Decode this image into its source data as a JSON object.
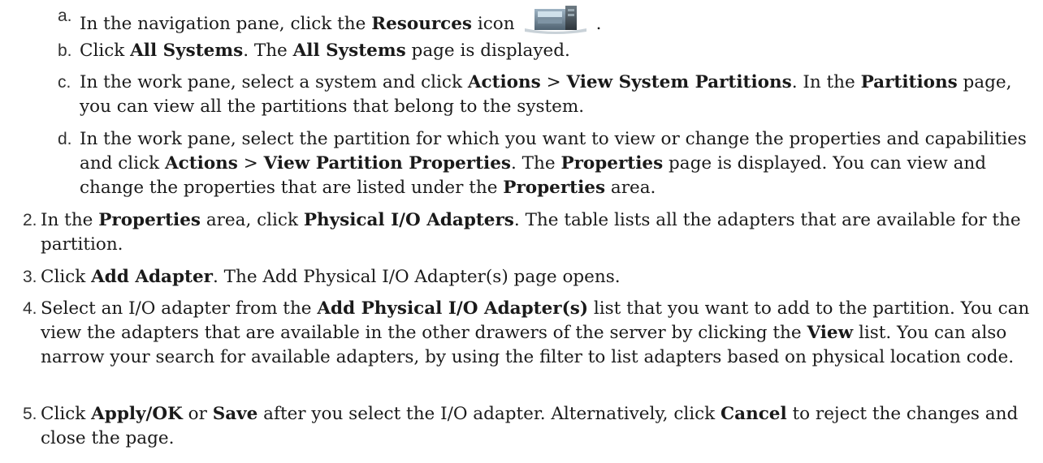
{
  "substeps": [
    {
      "label": "a.",
      "parts": [
        "In the navigation pane, click the ",
        "Resources",
        " icon",
        "."
      ],
      "icon": "resources-server-icon"
    },
    {
      "label": "b.",
      "parts": [
        "Click ",
        "All Systems",
        ". The ",
        "All Systems",
        " page is displayed."
      ]
    },
    {
      "label": "c.",
      "parts": [
        "In the work pane, select a system and click ",
        "Actions",
        " > ",
        "View System Partitions",
        ". In the ",
        "Partitions",
        " page, you can view all the partitions that belong to the system."
      ]
    },
    {
      "label": "d.",
      "parts": [
        "In the work pane, select the partition for which you want to view or change the properties and capabilities and click ",
        "Actions",
        " > ",
        "View Partition Properties",
        ". The ",
        "Properties",
        " page is displayed. You can view and change the properties that are listed under the ",
        "Properties",
        " area."
      ]
    }
  ],
  "steps": [
    {
      "label": "2.",
      "parts": [
        "In the ",
        "Properties",
        " area, click ",
        "Physical I/O Adapters",
        ". The table lists all the adapters that are available for the partition."
      ]
    },
    {
      "label": "3.",
      "parts": [
        "Click ",
        "Add Adapter",
        ". The Add Physical I/O Adapter(s) page opens."
      ]
    },
    {
      "label": "4.",
      "parts": [
        "Select an I/O adapter from the ",
        "Add Physical I/O Adapter(s)",
        " list that you want to add to the partition. You can view the adapters that are available in the other drawers of the server by clicking the ",
        "View",
        " list. You can also narrow your search for available adapters, by using the filter to list adapters based on physical location code."
      ]
    },
    {
      "label": "5.",
      "parts": [
        "Click ",
        "Apply/OK",
        " or ",
        "Save",
        " after you select the I/O adapter. Alternatively, click ",
        "Cancel",
        " to reject the changes and close the page."
      ]
    }
  ]
}
